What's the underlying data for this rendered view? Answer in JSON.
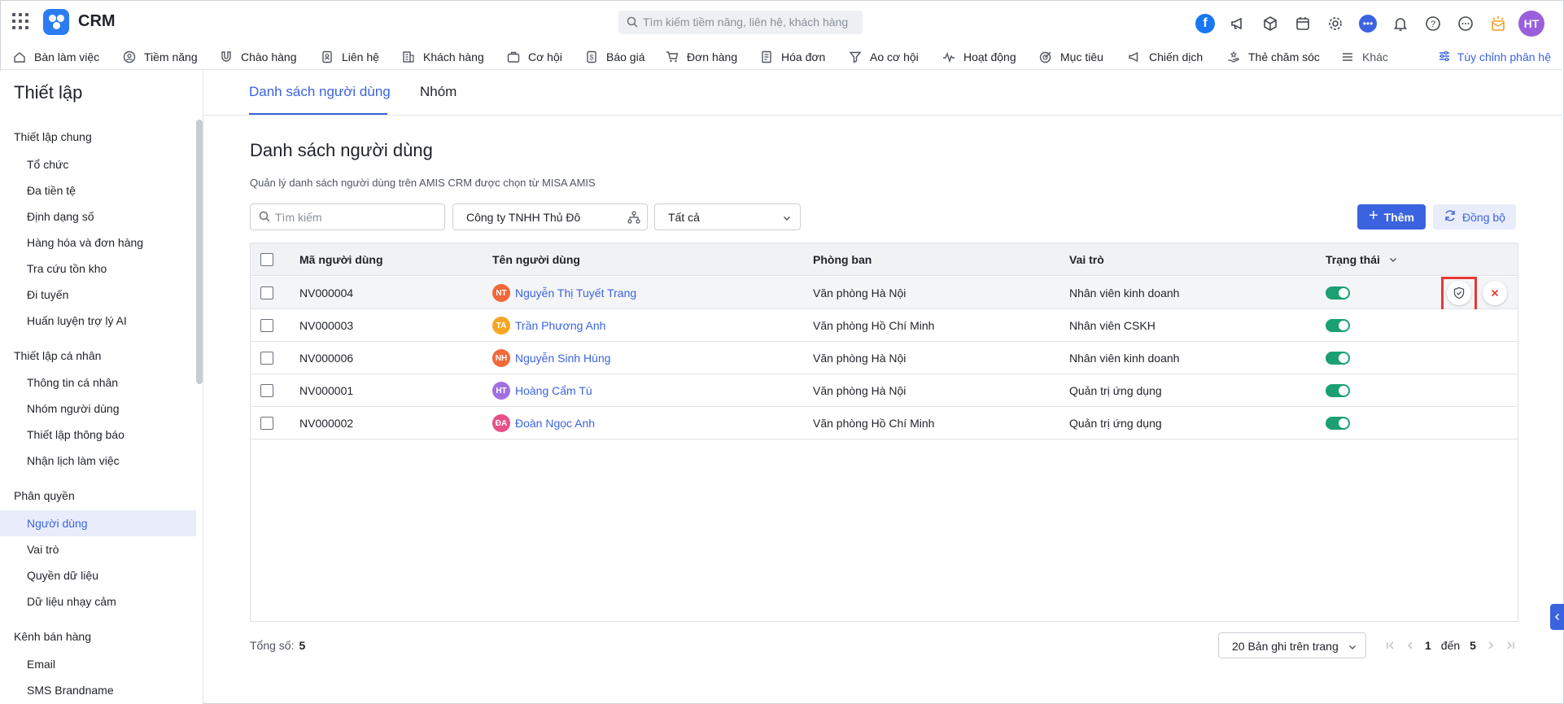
{
  "app": {
    "name": "CRM"
  },
  "search": {
    "placeholder": "Tìm kiếm tiềm năng, liên hệ, khách hàng"
  },
  "topbar": {
    "user_initials": "HT"
  },
  "nav": {
    "items": [
      {
        "label": "Bàn làm việc",
        "icon": "home-icon"
      },
      {
        "label": "Tiềm năng",
        "icon": "user-circle-icon"
      },
      {
        "label": "Chào hàng",
        "icon": "magnet-icon"
      },
      {
        "label": "Liên hệ",
        "icon": "contact-icon"
      },
      {
        "label": "Khách hàng",
        "icon": "building-icon"
      },
      {
        "label": "Cơ hội",
        "icon": "briefcase-icon"
      },
      {
        "label": "Báo giá",
        "icon": "quote-icon"
      },
      {
        "label": "Đơn hàng",
        "icon": "cart-icon"
      },
      {
        "label": "Hóa đơn",
        "icon": "invoice-icon"
      },
      {
        "label": "Ao cơ hội",
        "icon": "funnel-icon"
      },
      {
        "label": "Hoạt động",
        "icon": "activity-icon"
      },
      {
        "label": "Mục tiêu",
        "icon": "target-icon"
      },
      {
        "label": "Chiến dịch",
        "icon": "megaphone-icon"
      },
      {
        "label": "Thẻ chăm sóc",
        "icon": "care-card-icon"
      },
      {
        "label": "Khác",
        "icon": "menu-icon"
      }
    ],
    "customize": "Tùy chỉnh phân hệ"
  },
  "sidebar": {
    "title": "Thiết lập",
    "groups": [
      {
        "heading": "Thiết lập chung",
        "items": [
          "Tổ chức",
          "Đa tiền tệ",
          "Định dạng số",
          "Hàng hóa và đơn hàng",
          "Tra cứu tồn kho",
          "Đi tuyến",
          "Huấn luyện trợ lý AI"
        ]
      },
      {
        "heading": "Thiết lập cá nhân",
        "items": [
          "Thông tin cá nhân",
          "Nhóm người dùng",
          "Thiết lập thông báo",
          "Nhận lịch làm việc"
        ]
      },
      {
        "heading": "Phân quyền",
        "items": [
          "Người dùng",
          "Vai trò",
          "Quyền dữ liệu",
          "Dữ liệu nhạy cảm"
        ]
      },
      {
        "heading": "Kênh bán hàng",
        "items": [
          "Email",
          "SMS Brandname"
        ]
      }
    ],
    "active_item": "Người dùng"
  },
  "tabs": [
    "Danh sách người dùng",
    "Nhóm"
  ],
  "page": {
    "title": "Danh sách người dùng",
    "description": "Quản lý danh sách người dùng trên AMIS CRM được chọn từ MISA AMIS"
  },
  "filters": {
    "search_placeholder": "Tìm kiếm",
    "organization": "Công ty TNHH Thủ Đô",
    "status": "Tất cả"
  },
  "buttons": {
    "add": "Thêm",
    "sync": "Đồng bộ"
  },
  "table": {
    "columns": [
      "Mã người dùng",
      "Tên người dùng",
      "Phòng ban",
      "Vai trò",
      "Trạng thái"
    ],
    "rows": [
      {
        "code": "NV000004",
        "initials": "NT",
        "avatar_color": "#f2683a",
        "name": "Nguyễn Thị Tuyết Trang",
        "department": "Văn phòng Hà Nội",
        "role": "Nhân viên kinh doanh",
        "active": true
      },
      {
        "code": "NV000003",
        "initials": "TA",
        "avatar_color": "#f5a623",
        "name": "Trần Phương Anh",
        "department": "Văn phòng Hồ Chí Minh",
        "role": "Nhân viên CSKH",
        "active": true
      },
      {
        "code": "NV000006",
        "initials": "NH",
        "avatar_color": "#f2683a",
        "name": "Nguyễn Sinh Hùng",
        "department": "Văn phòng Hà Nội",
        "role": "Nhân viên kinh doanh",
        "active": true
      },
      {
        "code": "NV000001",
        "initials": "HT",
        "avatar_color": "#a070e0",
        "name": "Hoàng Cẩm Tú",
        "department": "Văn phòng Hà Nội",
        "role": "Quản trị ứng dụng",
        "active": true
      },
      {
        "code": "NV000002",
        "initials": "ĐA",
        "avatar_color": "#e8508a",
        "name": "Đoàn Ngọc Anh",
        "department": "Văn phòng Hồ Chí Minh",
        "role": "Quản trị ứng dụng",
        "active": true
      }
    ]
  },
  "footer": {
    "total_label": "Tổng số:",
    "total": "5",
    "page_size": "20 Bản ghi trên trang",
    "page_from": "1",
    "page_to_label": "đến",
    "page_to": "5"
  },
  "colors": {
    "accent": "#3b63e0",
    "toggle_on": "#1aa071",
    "highlight": "#e53935"
  }
}
